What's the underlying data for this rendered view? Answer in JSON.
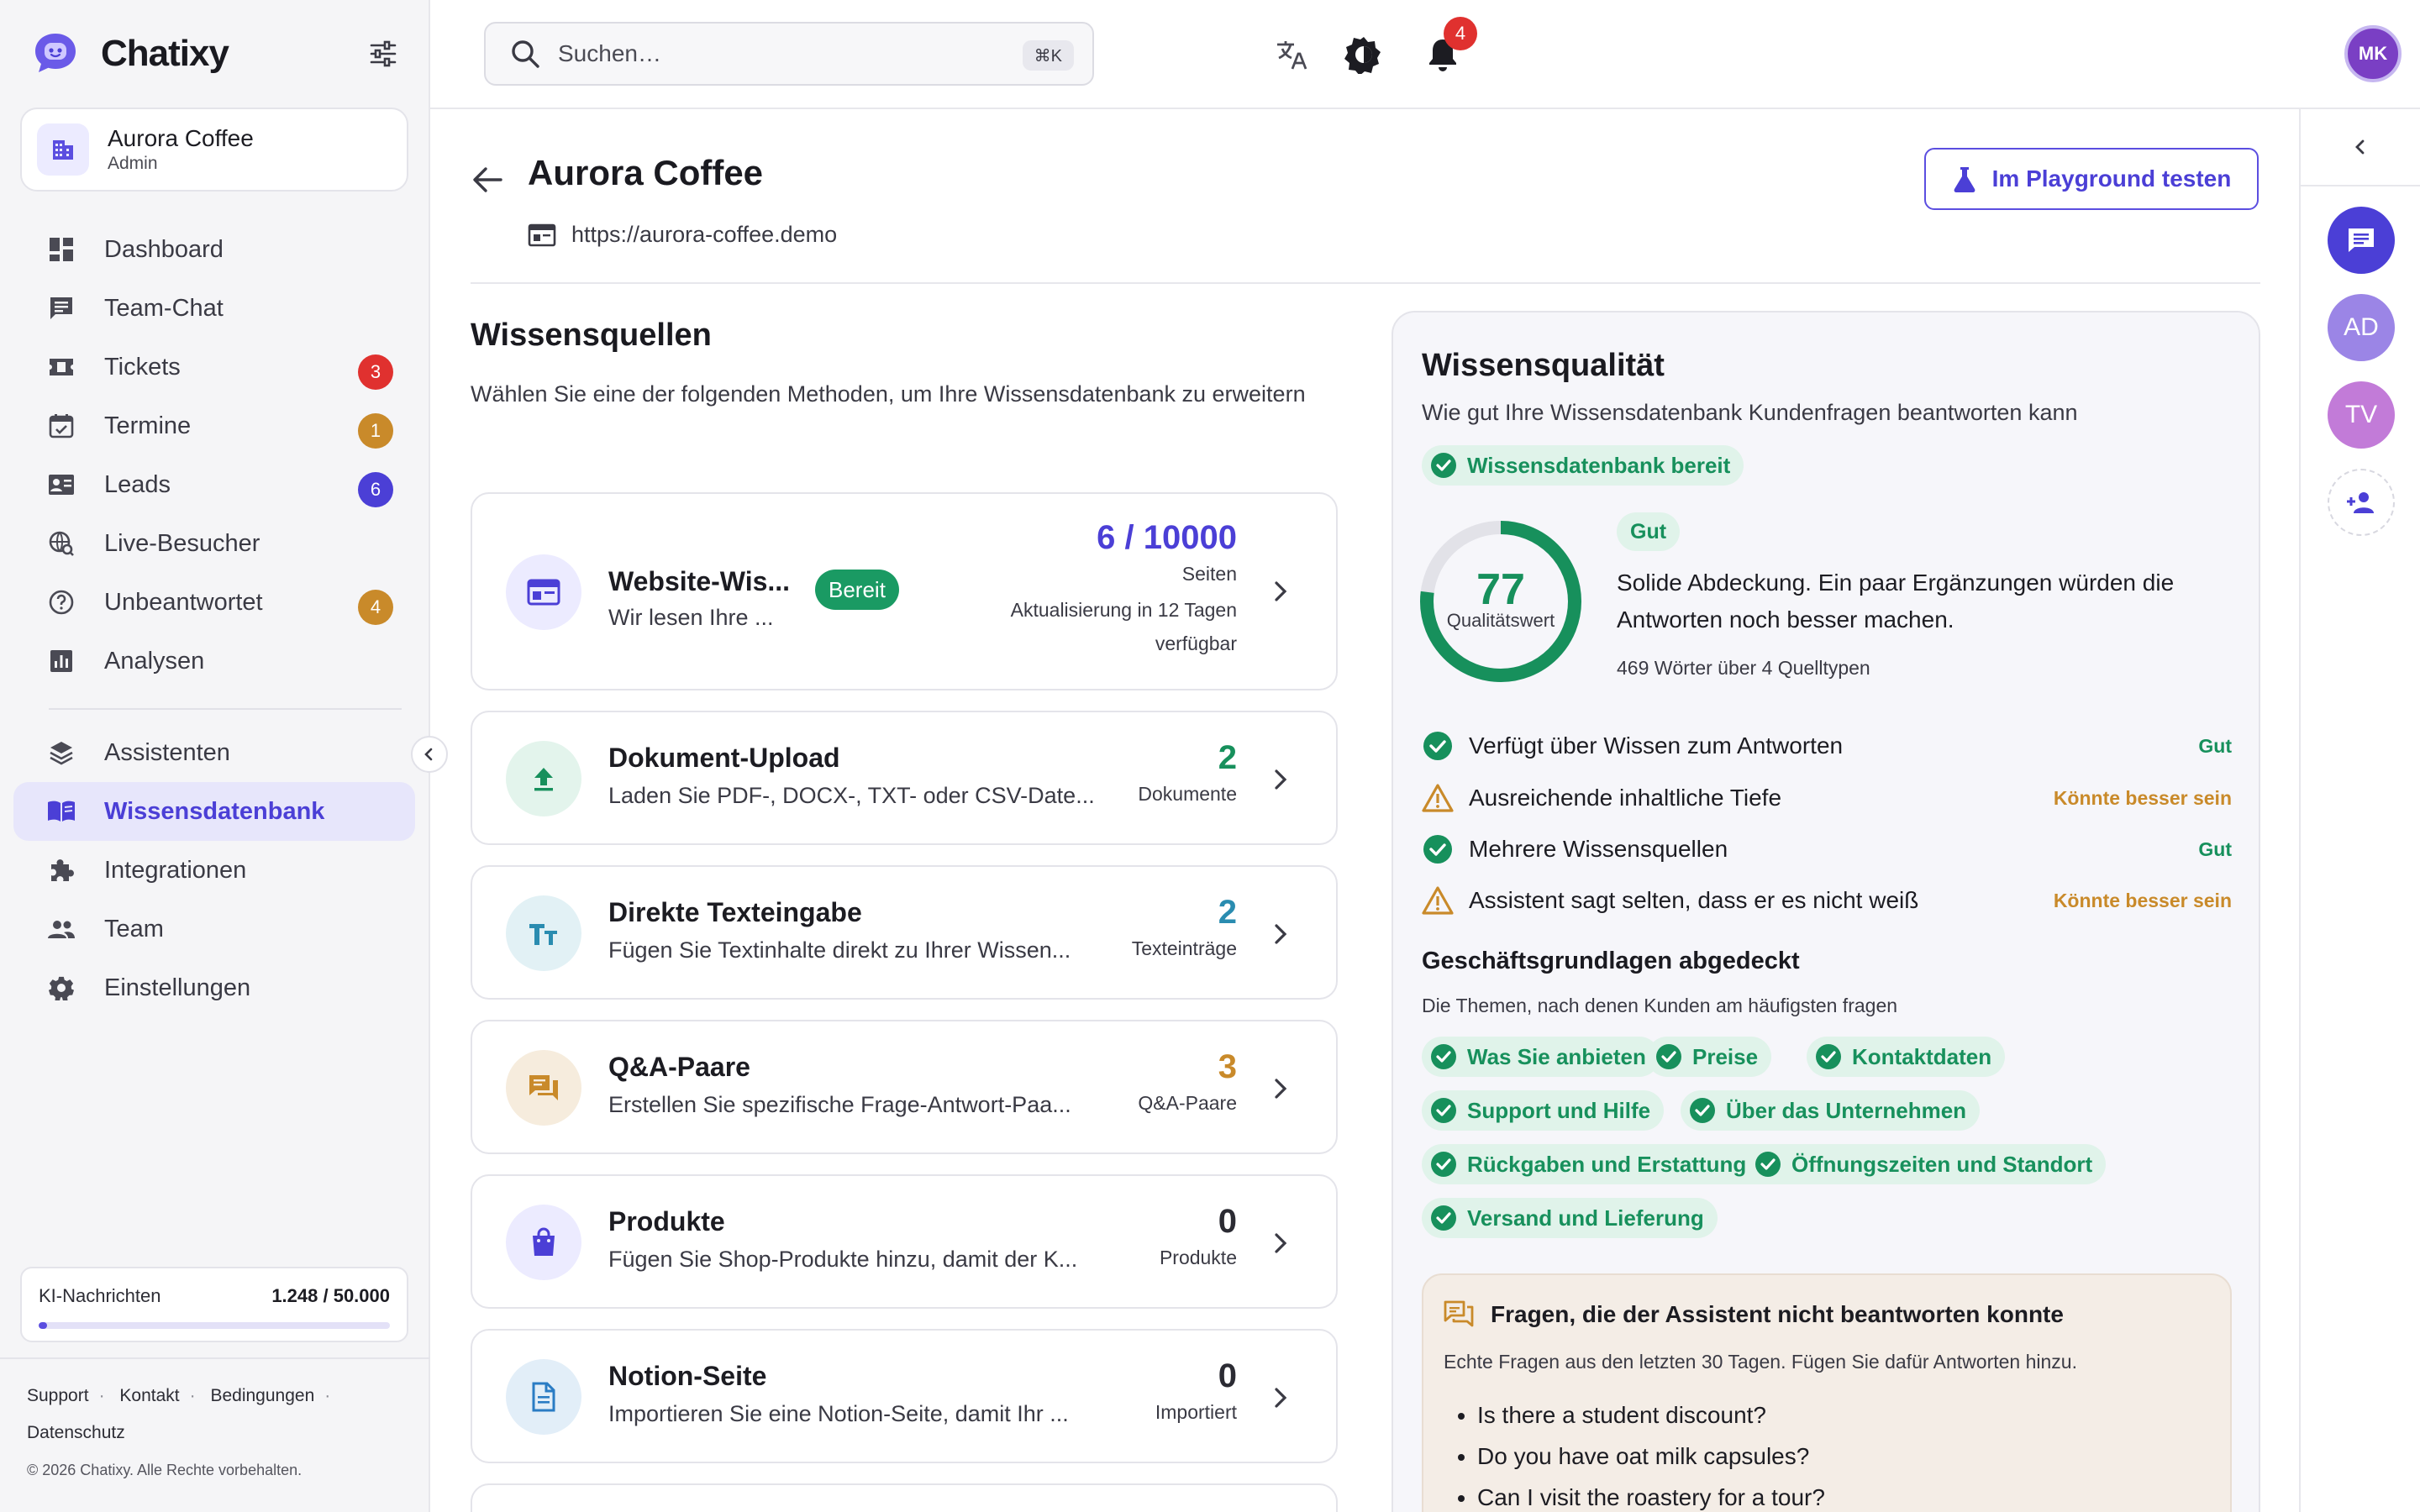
{
  "app": {
    "name": "Chatixy"
  },
  "org": {
    "name": "Aurora Coffee",
    "role": "Admin"
  },
  "nav": {
    "items": [
      {
        "label": "Dashboard"
      },
      {
        "label": "Team-Chat"
      },
      {
        "label": "Tickets",
        "badge": "3"
      },
      {
        "label": "Termine",
        "badge": "1"
      },
      {
        "label": "Leads",
        "badge": "6"
      },
      {
        "label": "Live-Besucher"
      },
      {
        "label": "Unbeantwortet",
        "badge": "4"
      },
      {
        "label": "Analysen"
      }
    ],
    "items2": [
      {
        "label": "Assistenten"
      },
      {
        "label": "Wissensdatenbank",
        "active": true
      },
      {
        "label": "Integrationen"
      },
      {
        "label": "Team"
      },
      {
        "label": "Einstellungen"
      }
    ]
  },
  "usage": {
    "label": "KI-Nachrichten",
    "value": "1.248 / 50.000",
    "fraction": 0.025
  },
  "footer": {
    "links": [
      "Support",
      "Kontakt",
      "Bedingungen",
      "Datenschutz"
    ],
    "copyright": "© 2026 Chatixy. Alle Rechte vorbehalten."
  },
  "topbar": {
    "search_placeholder": "Suchen…",
    "shortcut": "⌘K",
    "notifications": "4",
    "user_initials": "MK",
    "icons": [
      "translate-icon",
      "theme-icon",
      "bell-icon"
    ]
  },
  "rail": {
    "avatars": [
      {
        "initials": "AD",
        "color": "#9b85e6"
      },
      {
        "initials": "TV",
        "color": "#c27bd8"
      }
    ]
  },
  "page": {
    "title": "Aurora Coffee",
    "url": "https://aurora-coffee.demo",
    "playground_button": "Im Playground testen"
  },
  "sources": {
    "title": "Wissensquellen",
    "description": "Wählen Sie eine der folgenden Methoden, um Ihre Wissensdatenbank zu erweitern",
    "cards": [
      {
        "title": "Website-Wis...",
        "desc": "Wir lesen Ihre ...",
        "status": "Bereit",
        "value": "6 / 10000",
        "unit": "Seiten",
        "note": "Aktualisierung in 12 Tagen verfügbar",
        "color": "#4b3fd6",
        "icon": "website-icon"
      },
      {
        "title": "Dokument-Upload",
        "desc": "Laden Sie PDF-, DOCX-, TXT- oder CSV-Date...",
        "value": "2",
        "unit": "Dokumente",
        "color": "#17905c",
        "icon": "upload-icon"
      },
      {
        "title": "Direkte Texteingabe",
        "desc": "Fügen Sie Textinhalte direkt zu Ihrer Wissen...",
        "value": "2",
        "unit": "Texteinträge",
        "color": "#2a8cb0",
        "icon": "text-icon"
      },
      {
        "title": "Q&A-Paare",
        "desc": "Erstellen Sie spezifische Frage-Antwort-Paa...",
        "value": "3",
        "unit": "Q&A-Paare",
        "color": "#c98a2a",
        "icon": "qa-icon"
      },
      {
        "title": "Produkte",
        "desc": "Fügen Sie Shop-Produkte hinzu, damit der K...",
        "value": "0",
        "unit": "Produkte",
        "color": "#2b2b33",
        "icon": "shopping-bag-icon"
      },
      {
        "title": "Notion-Seite",
        "desc": "Importieren Sie eine Notion-Seite, damit Ihr ...",
        "value": "0",
        "unit": "Importiert",
        "color": "#2b2b33",
        "icon": "document-icon"
      }
    ]
  },
  "quality": {
    "title": "Wissensqualität",
    "subtitle": "Wie gut Ihre Wissensdatenbank Kundenfragen beantworten kann",
    "ready": "Wissensdatenbank bereit",
    "score": "77",
    "score_label": "Qualitätswert",
    "score_fraction": 0.77,
    "rating": "Gut",
    "summary": "Solide Abdeckung. Ein paar Ergänzungen würden die Antworten noch besser machen.",
    "words": "469 Wörter über 4 Quelltypen",
    "criteria": [
      {
        "label": "Verfügt über Wissen zum Antworten",
        "status": "Gut",
        "ok": true
      },
      {
        "label": "Ausreichende inhaltliche Tiefe",
        "status": "Könnte besser sein",
        "ok": false
      },
      {
        "label": "Mehrere Wissensquellen",
        "status": "Gut",
        "ok": true
      },
      {
        "label": "Assistent sagt selten, dass er es nicht weiß",
        "status": "Könnte besser sein",
        "ok": false
      }
    ],
    "basics_title": "Geschäftsgrundlagen abgedeckt",
    "basics_sub": "Die Themen, nach denen Kunden am häufigsten fragen",
    "topics": [
      "Was Sie anbieten",
      "Preise",
      "Kontaktdaten",
      "Support und Hilfe",
      "Über das Unternehmen",
      "Rückgaben und Erstattungen",
      "Öffnungszeiten und Standort",
      "Versand und Lieferung"
    ],
    "unanswered_title": "Fragen, die der Assistent nicht beantworten konnte",
    "unanswered_sub": "Echte Fragen aus den letzten 30 Tagen. Fügen Sie dafür Antworten hinzu.",
    "unanswered": [
      "Is there a student discount?",
      "Do you have oat milk capsules?",
      "Can I visit the roastery for a tour?"
    ]
  },
  "colors": {
    "accent": "#4b3fd6",
    "success": "#17905c",
    "warning": "#c98a2a",
    "danger": "#e0312f"
  }
}
